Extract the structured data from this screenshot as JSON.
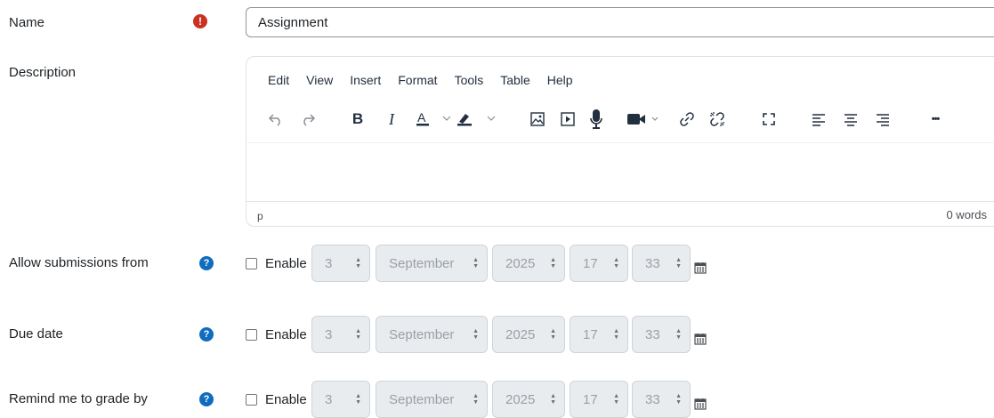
{
  "form": {
    "name_label": "Name",
    "name_value": "Assignment",
    "description_label": "Description",
    "required_icon": "exclamation-circle-icon",
    "help_icon": "question-circle-icon"
  },
  "editor": {
    "menu": [
      "Edit",
      "View",
      "Insert",
      "Format",
      "Tools",
      "Table",
      "Help"
    ],
    "toolbar_icons": [
      "undo-icon",
      "redo-icon",
      "bold-icon",
      "italic-icon",
      "text-color-icon",
      "highlight-color-icon",
      "image-icon",
      "media-icon",
      "record-audio-icon",
      "record-video-icon",
      "link-icon",
      "unlink-icon",
      "fullscreen-icon",
      "align-left-icon",
      "align-center-icon",
      "align-right-icon",
      "more-icon"
    ],
    "bold_glyph": "B",
    "italic_glyph": "I",
    "more_glyph": "•••",
    "path": "p",
    "word_count": "0 words"
  },
  "date_rows": [
    {
      "label": "Allow submissions from",
      "enable": "Enable",
      "day": "3",
      "month": "September",
      "year": "2025",
      "hour": "17",
      "minute": "33"
    },
    {
      "label": "Due date",
      "enable": "Enable",
      "day": "3",
      "month": "September",
      "year": "2025",
      "hour": "17",
      "minute": "33"
    },
    {
      "label": "Remind me to grade by",
      "enable": "Enable",
      "day": "3",
      "month": "September",
      "year": "2025",
      "hour": "17",
      "minute": "33"
    }
  ],
  "colors": {
    "required": "#ca3120",
    "help": "#0f6cbf",
    "text": "#1d2125"
  }
}
